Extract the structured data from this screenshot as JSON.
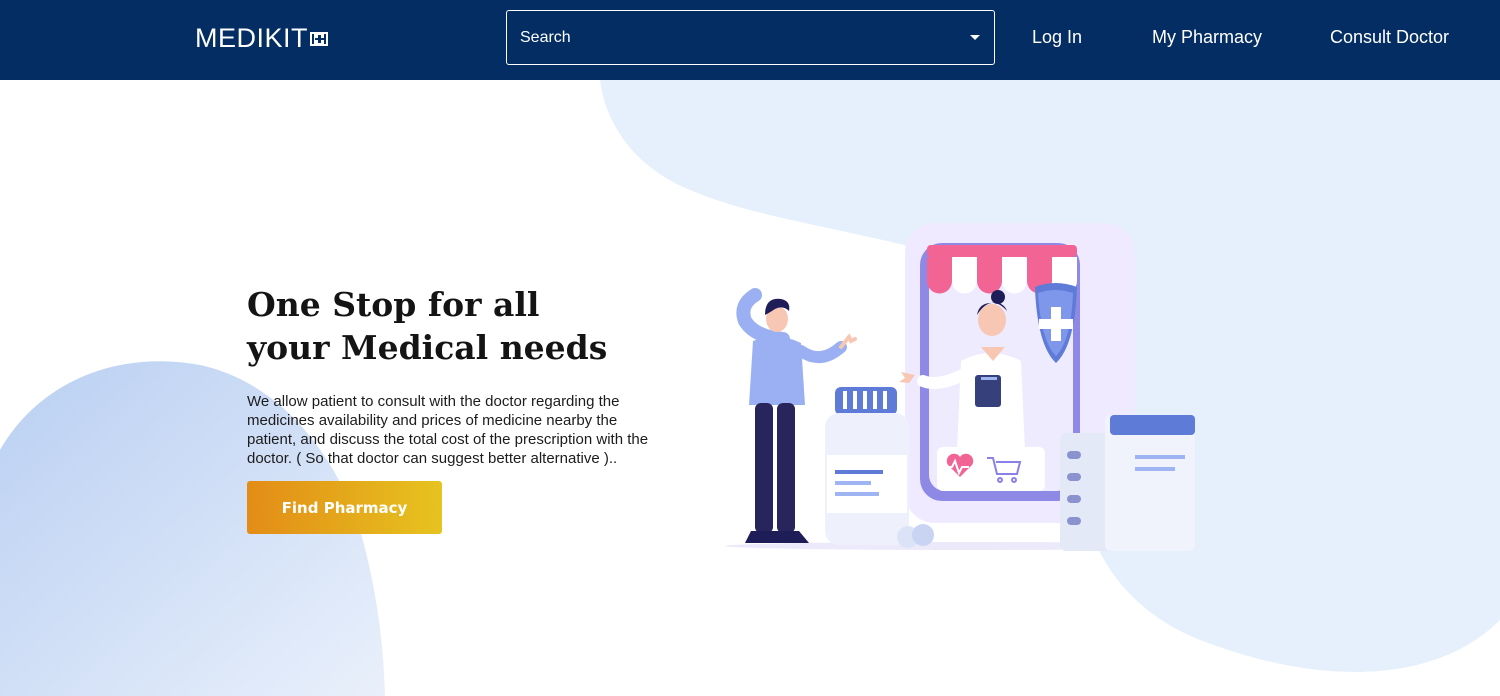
{
  "header": {
    "logo_text": "MEDIKIT",
    "search": {
      "placeholder": "Search"
    },
    "nav": {
      "login": "Log In",
      "my_pharmacy": "My Pharmacy",
      "consult_doctor": "Consult Doctor"
    }
  },
  "hero": {
    "title_line1": "One Stop for all",
    "title_line2": "your Medical needs",
    "description": "We allow patient to consult with the doctor regarding the medicines availability and prices of medicine nearby the patient, and discuss the total cost of the prescription with the doctor. ( So that doctor can suggest better alternative )..",
    "cta_label": "Find Pharmacy"
  },
  "colors": {
    "navbar": "#032d63",
    "cta_start": "#e38c17",
    "cta_end": "#e6c31f",
    "blob_light": "#e6f0fc",
    "blob_blue": "#c3d6f4"
  },
  "icons": [
    "caret-down-icon",
    "first-aid-kit-icon",
    "shield-cross-icon",
    "heart-icon",
    "cart-icon"
  ]
}
